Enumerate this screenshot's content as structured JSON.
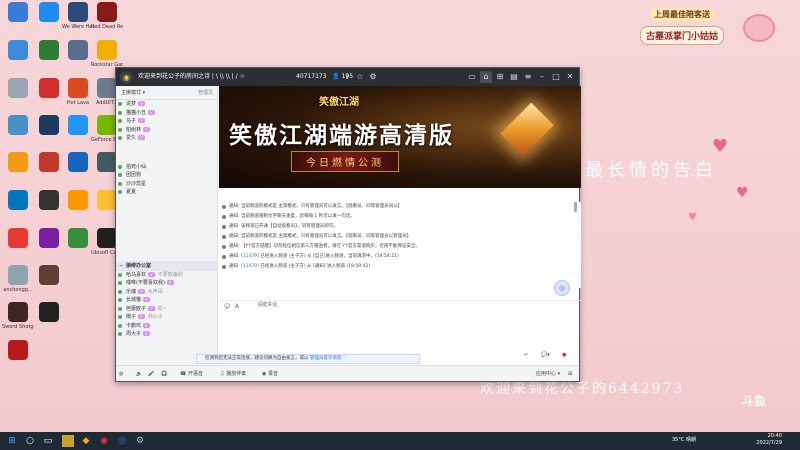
{
  "desktop_icons": [
    {
      "label": "",
      "icon": "app-icon",
      "color": "#3a7bd5"
    },
    {
      "label": "",
      "icon": "kugou-icon",
      "color": "#1d8df0"
    },
    {
      "label": "We Were Here 1...",
      "icon": "game-icon",
      "color": "#2b4a7a"
    },
    {
      "label": "Red Dead Redempt...",
      "icon": "rdr-icon",
      "color": "#8b1a1a"
    },
    {
      "label": "",
      "icon": "pc-icon",
      "color": "#3f8bd8"
    },
    {
      "label": "",
      "icon": "app-icon",
      "color": "#2e7d32"
    },
    {
      "label": "",
      "icon": "game-icon",
      "color": "#5a6d8b"
    },
    {
      "label": "Rockstar Games L...",
      "icon": "rockstar-icon",
      "color": "#f1b000"
    },
    {
      "label": "",
      "icon": "app-icon",
      "color": "#9aa5b1"
    },
    {
      "label": "",
      "icon": "netease-icon",
      "color": "#d22c2c"
    },
    {
      "label": "Hot Lava",
      "icon": "hotlava-icon",
      "color": "#d94b1e"
    },
    {
      "label": "AddUIT...",
      "icon": "app-icon",
      "color": "#6b7c8f"
    },
    {
      "label": "",
      "icon": "pc-icon",
      "color": "#4a90c8"
    },
    {
      "label": "",
      "icon": "app-icon",
      "color": "#1e3a5f"
    },
    {
      "label": "",
      "icon": "app-icon",
      "color": "#2196f3"
    },
    {
      "label": "GeForce Experience",
      "icon": "nvidia-icon",
      "color": "#76b900"
    },
    {
      "label": "",
      "icon": "app-icon",
      "color": "#f39c12"
    },
    {
      "label": "",
      "icon": "app-icon",
      "color": "#c0392b"
    },
    {
      "label": "",
      "icon": "app-icon",
      "color": "#1565c0"
    },
    {
      "label": "",
      "icon": "app-icon",
      "color": "#455a64"
    },
    {
      "label": "",
      "icon": "app-icon",
      "color": "#0277bd"
    },
    {
      "label": "",
      "icon": "app-icon",
      "color": "#333333"
    },
    {
      "label": "",
      "icon": "app-icon",
      "color": "#ff9800"
    },
    {
      "label": "",
      "icon": "app-icon",
      "color": "#fbc02d"
    },
    {
      "label": "",
      "icon": "qq-icon",
      "color": "#e53935"
    },
    {
      "label": "",
      "icon": "app-icon",
      "color": "#7b1fa2"
    },
    {
      "label": "",
      "icon": "app-icon",
      "color": "#388e3c"
    },
    {
      "label": "Ubisoft Connect",
      "icon": "ubisoft-icon",
      "color": "#202020"
    },
    {
      "label": "anchongg...",
      "icon": "app-icon",
      "color": "#90a4ae"
    },
    {
      "label": "",
      "icon": "app-icon",
      "color": "#5d4037"
    },
    {
      "label": "Sword Shotgun",
      "icon": "app-icon",
      "color": "#3e2723"
    },
    {
      "label": "",
      "icon": "app-icon",
      "color": "#212121"
    },
    {
      "label": "",
      "icon": "app-icon",
      "color": "#b71c1c"
    }
  ],
  "wallpaper": {
    "confession": "最长情的告白",
    "welcome": "欢迎来到花公子的6442973",
    "badge_line1": "上周最佳陪客送",
    "badge_line2": "古墓派掌门小姑姑",
    "watermark": "斗鱼"
  },
  "window": {
    "title": "欢迎来到花公子的房间之诗 | \\ \\\\ \\\\ | / ☆",
    "channel_id": "40717173",
    "online": "195"
  },
  "sidebar": {
    "mode": "主席模式",
    "manage": "管理员",
    "users_top": [
      "说梦",
      "猫猫小丑",
      "马子",
      "柏树林",
      "爱久"
    ],
    "users_mid": [
      "拍死小仙",
      "团团狗",
      "沙沙蕊星",
      "夏夏"
    ],
    "channel_name": "狼绯办公室",
    "users_bottom": [
      {
        "name": "哈乌喜欢",
        "tag": "不要欺骗别"
      },
      {
        "name": "嘿咻(不要喜欢我)",
        "tag": ""
      },
      {
        "name": "乐魂",
        "tag": "大声闹"
      },
      {
        "name": "长城猫",
        "tag": ""
      },
      {
        "name": "芭蕾欧子",
        "tag": "欢~"
      },
      {
        "name": "椒子",
        "tag": "帅公子"
      },
      {
        "name": "卡鹏鸡",
        "tag": ""
      },
      {
        "name": "周大子",
        "tag": ""
      }
    ]
  },
  "banner": {
    "game_logo": "笑傲江湖",
    "headline": "笑傲江湖端游高清版",
    "sub": "今日燃情公测"
  },
  "chat": {
    "messages": [
      {
        "prefix": "通知:",
        "text": "当前频道的模式是 主席模式，只有管理员可以发言。【观看员、同等管理员间以】",
        "blue": ""
      },
      {
        "prefix": "通知:",
        "text": "当前频道限制文字聊天速度，您每隔 1 秒可以发一句话。",
        "blue": ""
      },
      {
        "prefix": "通知:",
        "text": "该频道已开通【自动观看员】，同等管理员即可。",
        "blue": ""
      },
      {
        "prefix": "通知:",
        "text": "当前频道的模式是 主席模式，只有管理员可以发言。【观看员、同等管理员以管理员】",
        "blue": ""
      },
      {
        "prefix": "通知:",
        "text": "【YY官方提醒】切勿轻信相信第三方赠送者，请在 YY官方渠道购买，否则不能保证安全。",
        "blue": ""
      },
      {
        "prefix": "通知:",
        "text": "已经进入频道 (主子方) 从 [自己]进入频道，当前请求中。(19:54:21)",
        "blue": "[11479]"
      },
      {
        "prefix": "通知:",
        "text": "已经进入频道 (主子方) 从 [通知] 进入频道 (19:59:42)",
        "blue": "[11479]"
      }
    ],
    "input_placeholder": "请键讲话"
  },
  "toast": {
    "text": "检测到您无法正常连接，建议切换为自由发言，或以",
    "link": "管理员提示消息"
  },
  "composer": {
    "enter": "↵",
    "mode": "自动"
  },
  "bottombar": {
    "items": [
      "开语音",
      "播放伴奏",
      "录音"
    ],
    "right_label": "应用中心"
  },
  "taskbar": {
    "weather": "35°C 晴朗",
    "time": "20:40",
    "date": "2022/7/29"
  },
  "colors": {
    "wallpaper": "#f5d0d3",
    "titlebar": "#2b2e33",
    "accent": "#2d6fd6",
    "taskbar": "#1f2a36"
  }
}
